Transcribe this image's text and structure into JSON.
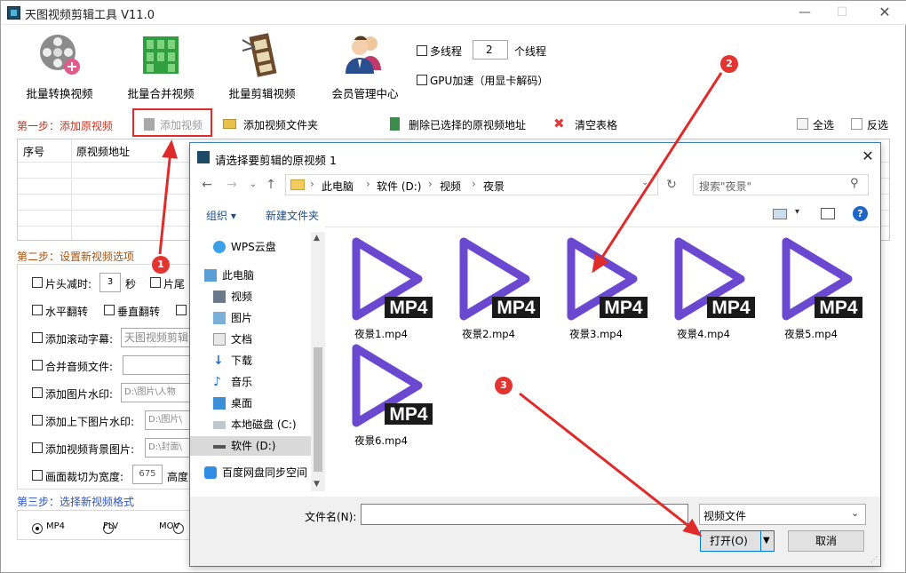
{
  "window": {
    "title": "天图视频剪辑工具 V11.0"
  },
  "toolbar": {
    "batch_convert": "批量转换视频",
    "batch_merge": "批量合并视频",
    "batch_cut": "批量剪辑视频",
    "member": "会员管理中心",
    "multithread_label": "多线程",
    "thread_count": "2",
    "thread_unit": "个线程",
    "gpu_label": "GPU加速（用显卡解码）"
  },
  "step1": {
    "title": "第一步：添加原视频",
    "add_video": "添加视频",
    "add_folder": "添加视频文件夹",
    "delete_selected": "删除已选择的原视频地址",
    "clear_table": "清空表格",
    "select_all": "全选",
    "invert": "反选",
    "col_index": "序号",
    "col_path": "原视频地址"
  },
  "step2": {
    "title": "第二步：设置新视频选项",
    "head_cut": "片头减时:",
    "head_cut_value": "3",
    "head_cut_unit": "秒",
    "tail_cut": "片尾",
    "hflip": "水平翻转",
    "vflip": "垂直翻转",
    "scroll_sub": "添加滚动字幕:",
    "scroll_sub_value": "天图视频剪辑",
    "merge_audio": "合并音频文件:",
    "img_watermark": "添加图片水印:",
    "img_watermark_value": "D:\\图片\\人物",
    "topbottom_img": "添加上下图片水印:",
    "topbottom_value": "D:\\图片\\",
    "bg_img": "添加视频背景图片:",
    "bg_img_value": "D:\\封面\\",
    "crop_width": "画面裁切为宽度:",
    "crop_width_value": "675",
    "crop_height": "高度"
  },
  "step3": {
    "title": "第三步：选择新视频格式",
    "formats": [
      "MP4",
      "FLV",
      "MOV"
    ],
    "selected": "MP4"
  },
  "dialog": {
    "title": "请选择要剪辑的原视频 1",
    "breadcrumb": [
      "此电脑",
      "软件 (D:)",
      "视频",
      "夜景"
    ],
    "search_placeholder": "搜索\"夜景\"",
    "organize": "组织",
    "new_folder": "新建文件夹",
    "nav": [
      {
        "label": "WPS云盘",
        "icon": "cloud-icon"
      },
      {
        "label": "此电脑",
        "icon": "computer-icon"
      },
      {
        "label": "视频",
        "icon": "video-folder-icon"
      },
      {
        "label": "图片",
        "icon": "picture-folder-icon"
      },
      {
        "label": "文档",
        "icon": "document-folder-icon"
      },
      {
        "label": "下载",
        "icon": "download-folder-icon"
      },
      {
        "label": "音乐",
        "icon": "music-folder-icon"
      },
      {
        "label": "桌面",
        "icon": "desktop-folder-icon"
      },
      {
        "label": "本地磁盘 (C:)",
        "icon": "disk-icon"
      },
      {
        "label": "软件 (D:)",
        "icon": "disk-icon"
      },
      {
        "label": "百度网盘同步空间",
        "icon": "baidu-cloud-icon"
      }
    ],
    "files": [
      "夜景1.mp4",
      "夜景2.mp4",
      "夜景3.mp4",
      "夜景4.mp4",
      "夜景5.mp4",
      "夜景6.mp4"
    ],
    "file_badge": "MP4",
    "filename_label": "文件名(N):",
    "filename_value": "",
    "filetype": "视频文件",
    "open_button": "打开(O)",
    "cancel_button": "取消"
  },
  "annotations": [
    "1",
    "2",
    "3"
  ],
  "colors": {
    "accent_red": "#e02b2b",
    "play_purple": "#6a48d0",
    "dialog_border": "#3c7fb1"
  }
}
